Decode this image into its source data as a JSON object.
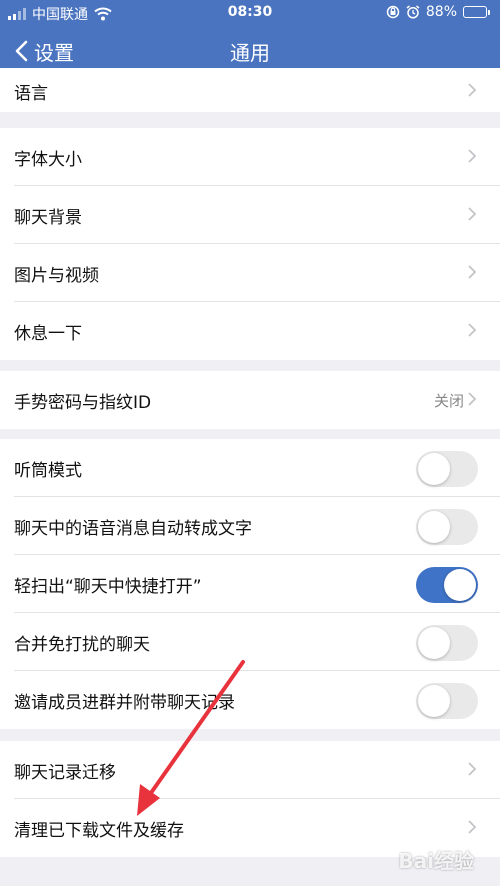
{
  "status_bar": {
    "carrier": "中国联通",
    "time": "08:30",
    "battery": "88%",
    "battery_level": 0.88,
    "icons": [
      "signal-icon",
      "wifi-icon",
      "rotation-lock-icon",
      "alarm-icon",
      "battery-icon"
    ]
  },
  "nav": {
    "back_label": "设置",
    "title": "通用"
  },
  "groups": {
    "g0": [
      {
        "label": "语言"
      }
    ],
    "g1": [
      {
        "label": "字体大小"
      },
      {
        "label": "聊天背景"
      },
      {
        "label": "图片与视频"
      },
      {
        "label": "休息一下"
      }
    ],
    "g2": [
      {
        "label": "手势密码与指纹ID",
        "value": "关闭"
      }
    ],
    "g3": [
      {
        "label": "听筒模式",
        "on": false
      },
      {
        "label": "聊天中的语音消息自动转成文字",
        "on": false
      },
      {
        "label": "轻扫出“聊天中快捷打开”",
        "on": true
      },
      {
        "label": "合并免打扰的聊天",
        "on": false
      },
      {
        "label": "邀请成员进群并附带聊天记录",
        "on": false
      }
    ],
    "g4": [
      {
        "label": "聊天记录迁移"
      },
      {
        "label": "清理已下载文件及缓存"
      }
    ]
  },
  "colors": {
    "header": "#4a74c0",
    "toggle_on": "#3f73c7",
    "annotation_arrow": "#e8323c"
  },
  "watermark": "Bai经验"
}
